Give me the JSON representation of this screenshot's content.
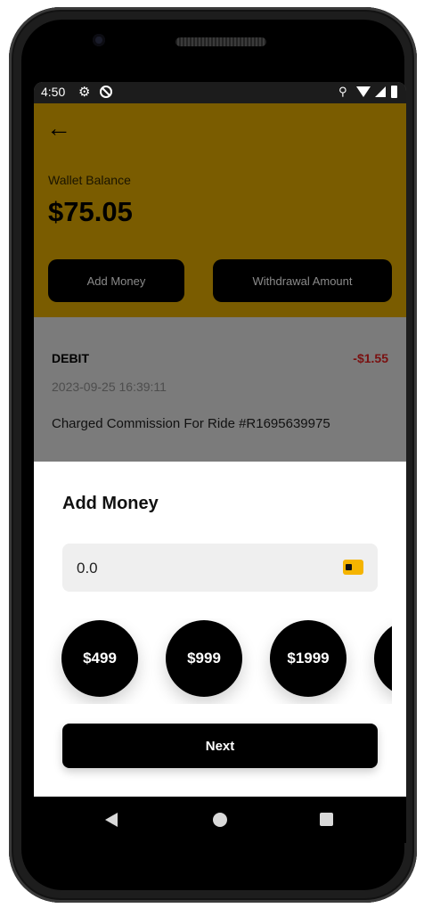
{
  "status_bar": {
    "time": "4:50",
    "icons": [
      "gear-icon",
      "do-not-disturb-icon",
      "location-icon",
      "wifi-icon",
      "signal-icon",
      "battery-icon"
    ]
  },
  "header": {
    "back_icon": "arrow-left-icon",
    "wallet_label": "Wallet Balance",
    "wallet_amount": "$75.05",
    "add_money_label": "Add Money",
    "withdraw_label": "Withdrawal Amount",
    "accent_color": "#f5b400"
  },
  "transaction": {
    "type": "DEBIT",
    "amount": "-$1.55",
    "date": "2023-09-25 16:39:11",
    "description": "Charged Commission For Ride #R1695639975",
    "amount_color": "#c0392b"
  },
  "sheet": {
    "title": "Add Money",
    "amount_value": "0.0",
    "field_icon": "wallet-icon",
    "presets": [
      "$499",
      "$999",
      "$1999",
      ""
    ],
    "next_label": "Next"
  },
  "nav_bar": {
    "icons": [
      "back-triangle-icon",
      "home-circle-icon",
      "recents-square-icon"
    ]
  }
}
